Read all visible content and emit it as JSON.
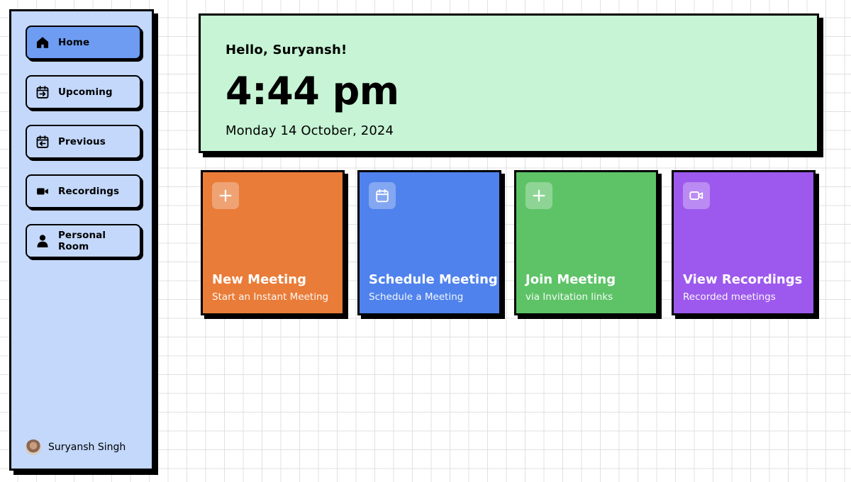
{
  "colors": {
    "sidebar_bg": "#c3d8fb",
    "sidebar_active": "#6d9cf2",
    "hero_bg": "#c6f4d4",
    "card_orange": "#e97c38",
    "card_blue": "#4f82ec",
    "card_green": "#5ec367",
    "card_purple": "#9d59ed"
  },
  "sidebar": {
    "items": [
      {
        "label": "Home",
        "icon": "home-icon",
        "active": true
      },
      {
        "label": "Upcoming",
        "icon": "calendar-arrow-right-icon",
        "active": false
      },
      {
        "label": "Previous",
        "icon": "calendar-arrow-left-icon",
        "active": false
      },
      {
        "label": "Recordings",
        "icon": "video-camera-icon",
        "active": false
      },
      {
        "label": "Personal Room",
        "icon": "person-icon",
        "active": false
      }
    ],
    "user": {
      "name": "Suryansh Singh"
    }
  },
  "hero": {
    "greeting": "Hello, Suryansh!",
    "time": "4:44 pm",
    "date": "Monday 14 October, 2024"
  },
  "cards": [
    {
      "title": "New Meeting",
      "subtitle": "Start an Instant Meeting",
      "icon": "plus-icon",
      "color": "#e97c38"
    },
    {
      "title": "Schedule Meeting",
      "subtitle": "Schedule a Meeting",
      "icon": "calendar-icon",
      "color": "#4f82ec"
    },
    {
      "title": "Join Meeting",
      "subtitle": "via Invitation links",
      "icon": "plus-icon",
      "color": "#5ec367"
    },
    {
      "title": "View Recordings",
      "subtitle": "Recorded meetings",
      "icon": "video-icon",
      "color": "#9d59ed"
    }
  ]
}
